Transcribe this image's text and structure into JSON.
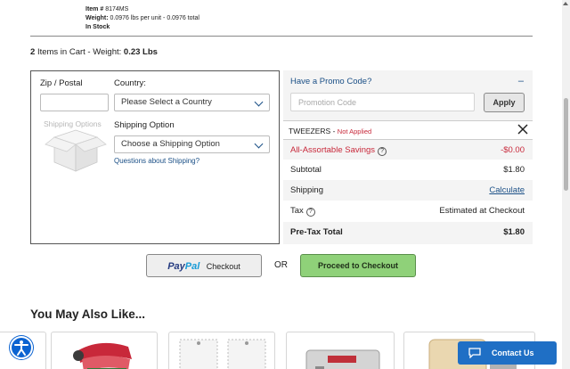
{
  "item": {
    "number_label": "Item #",
    "number": "8174MS",
    "weight_label": "Weight:",
    "weight": "0.0976 lbs per unit - 0.0976 total",
    "stock": "In Stock"
  },
  "cart": {
    "count": "2",
    "text": "Items in Cart - Weight:",
    "weight": "0.23 Lbs"
  },
  "shipping_form": {
    "zip_label": "Zip / Postal",
    "zip_value": "",
    "country_label": "Country:",
    "country_selected": "Please Select a Country",
    "image_label": "Shipping Options",
    "option_label": "Shipping Option",
    "option_selected": "Choose a Shipping Option",
    "questions_link": "Questions about Shipping?"
  },
  "promo": {
    "title": "Have a Promo Code?",
    "toggle": "–",
    "placeholder": "Promotion Code",
    "value": "",
    "apply_label": "Apply"
  },
  "summary": {
    "tweezers_label": "TWEEZERS -",
    "tweezers_status": "Not Applied",
    "savings_label": "All-Assortable Savings",
    "savings_value": "-$0.00",
    "subtotal_label": "Subtotal",
    "subtotal_value": "$1.80",
    "shipping_label": "Shipping",
    "shipping_value": "Calculate",
    "tax_label": "Tax",
    "tax_value": "Estimated at Checkout",
    "pretax_label": "Pre-Tax Total",
    "pretax_value": "$1.80"
  },
  "checkout": {
    "paypal_pay": "Pay",
    "paypal_pal": "Pal",
    "paypal_checkout": "Checkout",
    "or": "OR",
    "proceed_label": "Proceed to Checkout"
  },
  "recommendations": {
    "title": "You May Also Like..."
  },
  "widgets": {
    "contact_label": "Contact Us"
  },
  "colors": {
    "link_blue": "#1a4f86",
    "savings_red": "#c8283a",
    "checkout_green": "#8fd179",
    "contact_blue": "#1f6fc5"
  }
}
